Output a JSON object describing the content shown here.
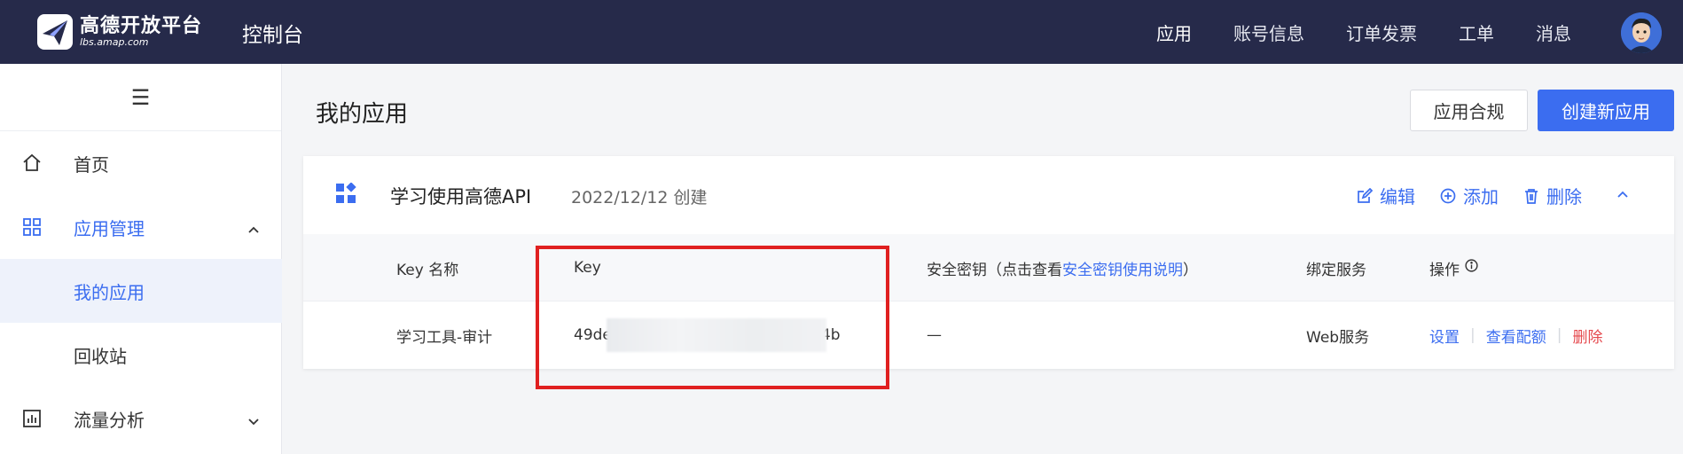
{
  "header": {
    "logo_title": "高德开放平台",
    "logo_sub": "lbs.amap.com",
    "console_title": "控制台",
    "nav": [
      "应用",
      "账号信息",
      "订单发票",
      "工单",
      "消息"
    ]
  },
  "sidebar": {
    "toggle": "☰",
    "items": [
      {
        "label": "首页",
        "icon": "home-icon"
      },
      {
        "label": "应用管理",
        "icon": "grid-icon"
      },
      {
        "label": "我的应用"
      },
      {
        "label": "回收站"
      },
      {
        "label": "流量分析",
        "icon": "chart-icon"
      }
    ]
  },
  "main": {
    "title": "我的应用",
    "compliance_btn": "应用合规",
    "create_btn": "创建新应用",
    "app": {
      "name": "学习使用高德API",
      "date": "2022/12/12 创建",
      "actions": {
        "edit": "编辑",
        "add": "添加",
        "delete": "删除"
      }
    },
    "table": {
      "headers": {
        "key_name": "Key 名称",
        "key": "Key",
        "secret_prefix": "安全密钥（点击查看",
        "secret_link": "安全密钥使用说明",
        "secret_suffix": "）",
        "service": "绑定服务",
        "ops": "操作"
      },
      "row": {
        "key_name": "学习工具-审计",
        "key_start": "49de",
        "key_end": "4b",
        "secret": "—",
        "service": "Web服务",
        "ops": {
          "settings": "设置",
          "quota": "查看配额",
          "delete": "删除"
        }
      }
    }
  },
  "colors": {
    "topbar": "#262a4a",
    "primary": "#3b6df0",
    "danger": "#e5484d",
    "highlight": "#e02020"
  }
}
